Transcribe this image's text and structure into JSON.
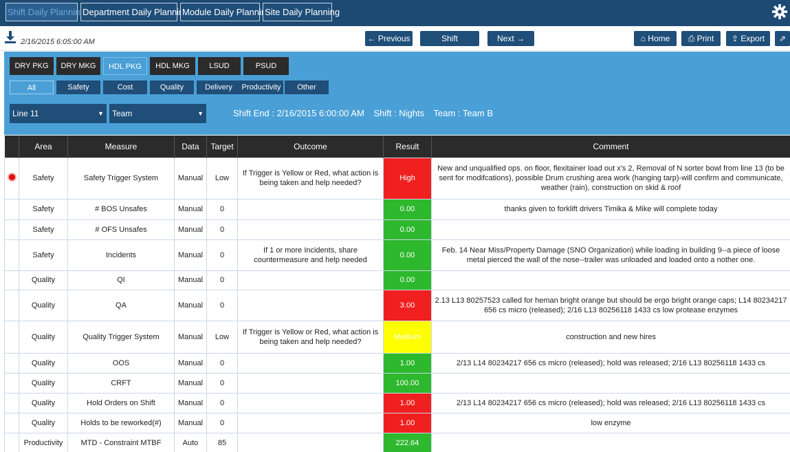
{
  "nav": {
    "tabs": [
      {
        "label": "Shift Daily Planning",
        "active": true
      },
      {
        "label": "Department Daily Planning",
        "active": false
      },
      {
        "label": "Module Daily Planning",
        "active": false
      },
      {
        "label": "Site Daily Planning",
        "active": false
      }
    ]
  },
  "toolbar": {
    "timestamp": "2/16/2015 6:05:00 AM",
    "previous_label": "← Previous",
    "shift_label": "Shift",
    "next_label": "Next →",
    "home_label": "⌂ Home",
    "print_label": "⎙ Print",
    "export_label": "⇪ Export",
    "extra_label": "⇗"
  },
  "dept_tabs": [
    "DRY PKG",
    "DRY MKG",
    "HDL PKG",
    "HDL MKG",
    "LSUD",
    "PSUD"
  ],
  "dept_active": "HDL PKG",
  "filter_tabs": [
    "All",
    "Safety",
    "Cost",
    "Quality",
    "Delivery",
    "Productivity",
    "Other"
  ],
  "filter_active": "All",
  "line_select": "Line 11",
  "team_select": "Team",
  "shift_info": {
    "shift_end": "Shift End : 2/16/2015 6:00:00 AM",
    "shift": "Shift : Nights",
    "team": "Team : Team B"
  },
  "table": {
    "headers": [
      "",
      "Area",
      "Measure",
      "Data",
      "Target",
      "Outcome",
      "Result",
      "Comment"
    ],
    "rows": [
      {
        "flag": true,
        "area": "Safety",
        "measure": "Safety Trigger System",
        "data": "Manual",
        "target": "Low",
        "outcome": "If Trigger is Yellow or Red, what action is being taken and help needed?",
        "result": "High",
        "status": "red",
        "comment": "New and unqualified ops. on floor, flexitainer load out x's 2, Removal of N sorter bowl from line 13 (to be sent for modifcations), possible Drum crushing area work (hanging tarp)-will confirm and communicate, weather (rain), construction on skid & roof"
      },
      {
        "flag": false,
        "area": "Safety",
        "measure": "# BOS Unsafes",
        "data": "Manual",
        "target": "0",
        "outcome": "",
        "result": "0.00",
        "status": "green",
        "comment": "thanks given to forklift drivers Timika & Mike will complete today"
      },
      {
        "flag": false,
        "area": "Safety",
        "measure": "# OFS Unsafes",
        "data": "Manual",
        "target": "0",
        "outcome": "",
        "result": "0.00",
        "status": "green",
        "comment": ""
      },
      {
        "flag": false,
        "area": "Safety",
        "measure": "Incidents",
        "data": "Manual",
        "target": "0",
        "outcome": "If 1 or more Incidents, share countermeasure and help needed",
        "result": "0.00",
        "status": "green",
        "comment": "Feb. 14 Near Miss/Property Damage (SNO Organization) while loading in building 9--a piece of loose metal pierced the wall of the nose--trailer was unloaded and loaded onto a nother one."
      },
      {
        "flag": false,
        "area": "Quality",
        "measure": "QI",
        "data": "Manual",
        "target": "0",
        "outcome": "",
        "result": "0.00",
        "status": "green",
        "comment": ""
      },
      {
        "flag": false,
        "area": "Quality",
        "measure": "QA",
        "data": "Manual",
        "target": "0",
        "outcome": "",
        "result": "3.00",
        "status": "red",
        "comment": "2.13 L13 80257523 called for heman bright orange but should be ergo bright orange caps; L14 80234217 656 cs micro (released); 2/16 L13 80256118 1433 cs low protease enzymes"
      },
      {
        "flag": false,
        "area": "Quality",
        "measure": "Quality Trigger System",
        "data": "Manual",
        "target": "Low",
        "outcome": "If Trigger is Yellow or Red, what action is being taken and help needed?",
        "result": "Medium",
        "status": "yellow",
        "comment": "construction and new hires"
      },
      {
        "flag": false,
        "area": "Quality",
        "measure": "OOS",
        "data": "Manual",
        "target": "0",
        "outcome": "",
        "result": "1.00",
        "status": "green",
        "comment": "2/13 L14 80234217 656 cs micro (released); hold was released; 2/16 L13 80256118 1433 cs"
      },
      {
        "flag": false,
        "area": "Quality",
        "measure": "CRFT",
        "data": "Manual",
        "target": "0",
        "outcome": "",
        "result": "100.00",
        "status": "green",
        "comment": ""
      },
      {
        "flag": false,
        "area": "Quality",
        "measure": "Hold Orders on Shift",
        "data": "Manual",
        "target": "0",
        "outcome": "",
        "result": "1.00",
        "status": "red",
        "comment": "2/13 L14 80234217 656 cs micro (released); hold was released; 2/16 L13 80256118 1433 cs"
      },
      {
        "flag": false,
        "area": "Quality",
        "measure": "Holds to be reworked(#)",
        "data": "Manual",
        "target": "0",
        "outcome": "",
        "result": "1.00",
        "status": "red",
        "comment": "low enzyme"
      },
      {
        "flag": false,
        "area": "Productivity",
        "measure": "MTD - Constraint MTBF",
        "data": "Auto",
        "target": "85",
        "outcome": "",
        "result": "222.64",
        "status": "green",
        "comment": ""
      }
    ]
  },
  "colors": {
    "nav_bg": "#1d4a73",
    "panel_bg": "#4aa0d6",
    "button_bg": "#1f4e79",
    "green": "#2db82d",
    "red": "#f02020",
    "yellow": "#ffff00"
  },
  "icons": {
    "gear": "gear-icon",
    "download": "download-icon",
    "flag": "red-dot-icon"
  }
}
